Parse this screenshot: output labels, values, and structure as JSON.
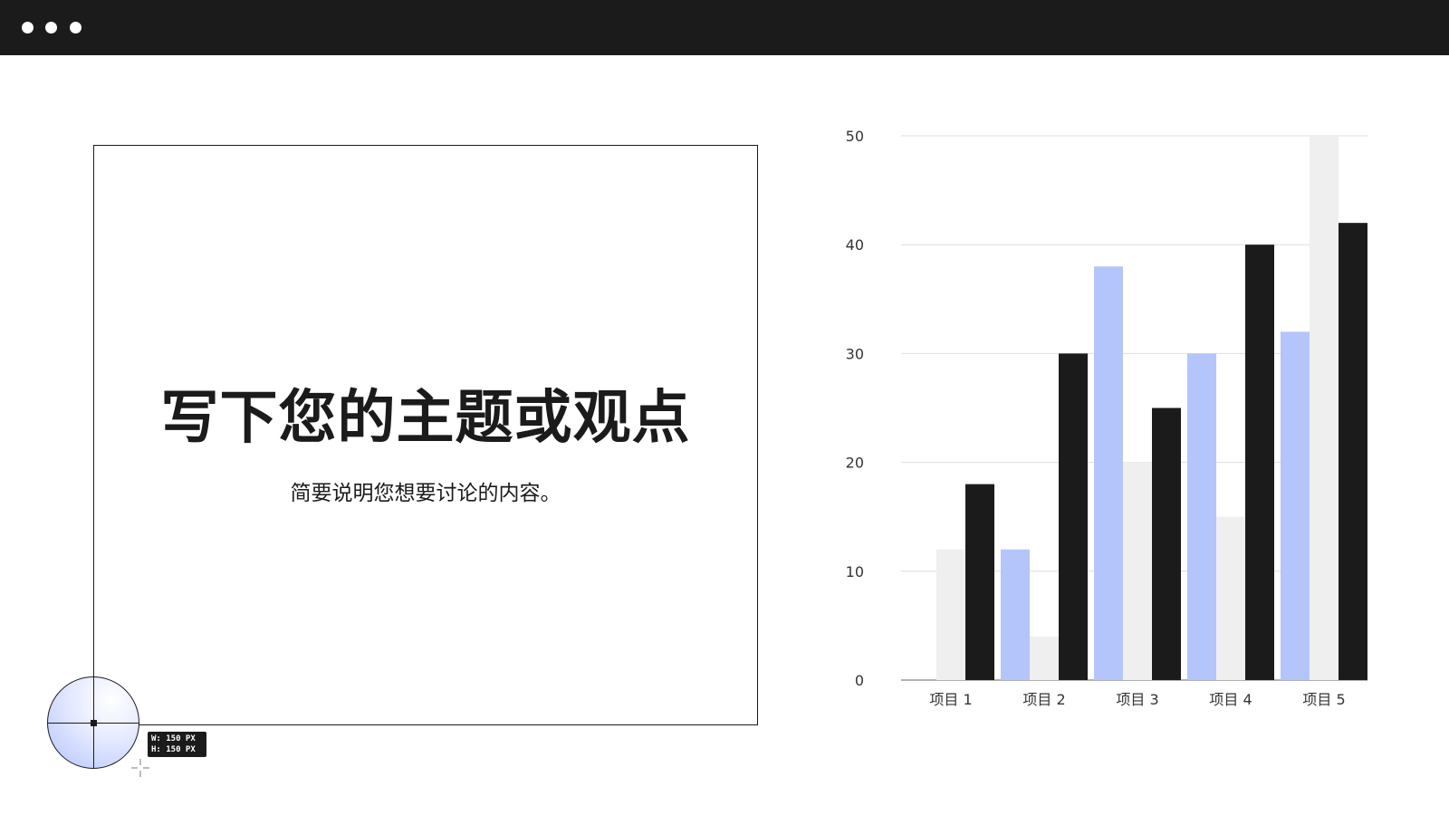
{
  "headline": "写下您的主题或观点",
  "subline": "简要说明您想要讨论的内容。",
  "size_tag": {
    "w": "W: 150 PX",
    "h": "H: 150 PX"
  },
  "colors": {
    "topbar": "#1b1b1b",
    "series_a": "#b3c5fb",
    "series_b": "#efefef",
    "series_c": "#1b1b1b",
    "grid": "#dddddd"
  },
  "icons": [
    "window-dot-icon",
    "crosshair-icon",
    "move-cursor-icon"
  ],
  "chart_data": {
    "type": "bar",
    "categories": [
      "项目 1",
      "项目 2",
      "项目 3",
      "项目 4",
      "项目 5"
    ],
    "series": [
      {
        "values": [
          0,
          12,
          38,
          30,
          32
        ],
        "color": "#b3c5fb"
      },
      {
        "values": [
          12,
          4,
          20,
          15,
          50
        ],
        "color": "#efefef"
      },
      {
        "values": [
          18,
          30,
          25,
          40,
          42
        ],
        "color": "#1b1b1b"
      }
    ],
    "ylim": [
      0,
      50
    ],
    "yticks": [
      0,
      10,
      20,
      30,
      40,
      50
    ],
    "grid": true,
    "legend": "none"
  }
}
